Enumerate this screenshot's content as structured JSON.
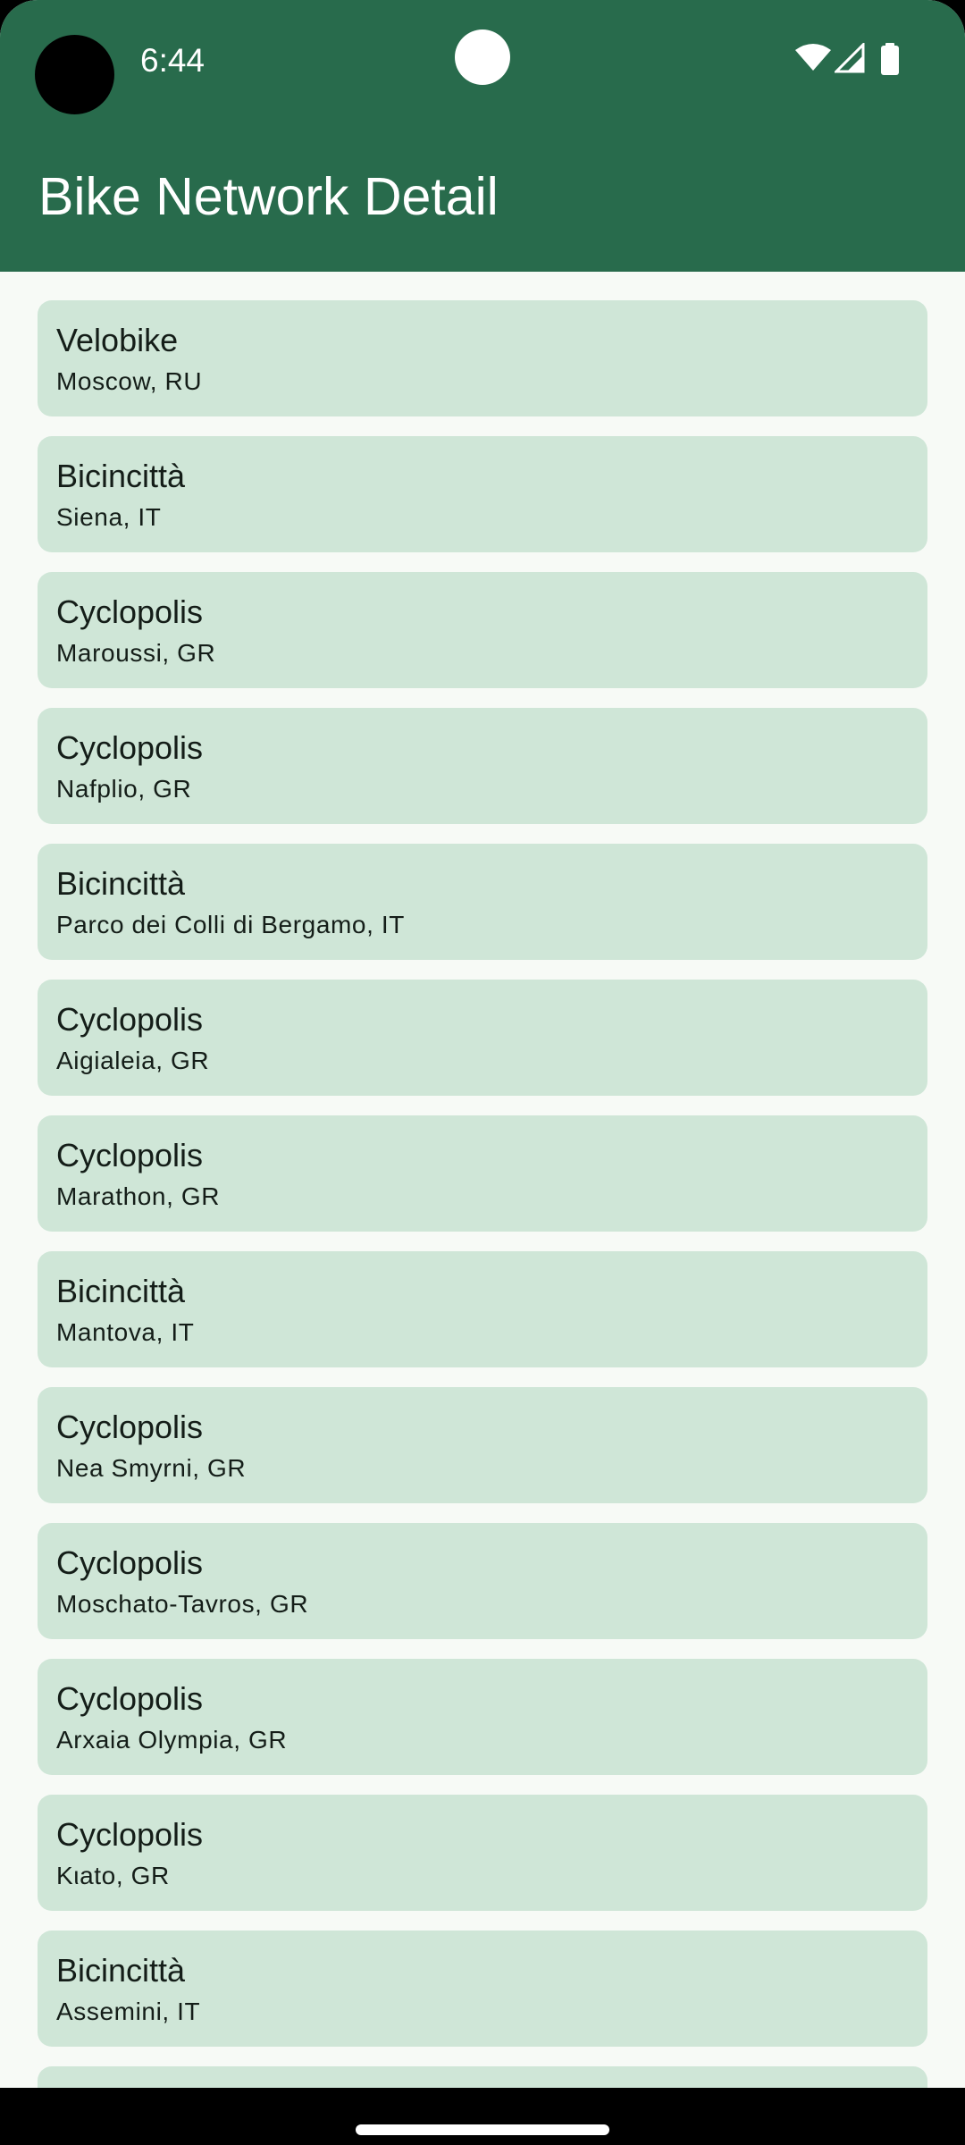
{
  "status_bar": {
    "time": "6:44",
    "icons": [
      "wifi-icon",
      "cellular-signal-icon",
      "battery-icon"
    ]
  },
  "app_bar": {
    "title": "Bike Network Detail"
  },
  "networks": [
    {
      "name": "Velobike",
      "location": "Moscow, RU"
    },
    {
      "name": "Bicincittà",
      "location": "Siena, IT"
    },
    {
      "name": "Cyclopolis",
      "location": "Maroussi, GR"
    },
    {
      "name": "Cyclopolis",
      "location": "Nafplio, GR"
    },
    {
      "name": "Bicincittà",
      "location": "Parco dei Colli di Bergamo, IT"
    },
    {
      "name": "Cyclopolis",
      "location": "Aigialeia, GR"
    },
    {
      "name": "Cyclopolis",
      "location": "Marathon, GR"
    },
    {
      "name": "Bicincittà",
      "location": "Mantova, IT"
    },
    {
      "name": "Cyclopolis",
      "location": "Nea Smyrni, GR"
    },
    {
      "name": "Cyclopolis",
      "location": "Moschato-Tavros, GR"
    },
    {
      "name": "Cyclopolis",
      "location": "Arxaia Olympia, GR"
    },
    {
      "name": "Cyclopolis",
      "location": "Kιato, GR"
    },
    {
      "name": "Bicincittà",
      "location": "Assemini, IT"
    }
  ],
  "colors": {
    "app_bar": "#286b4c",
    "background": "#f7faf6",
    "card": "#cfe6d7",
    "text": "#141d18"
  }
}
